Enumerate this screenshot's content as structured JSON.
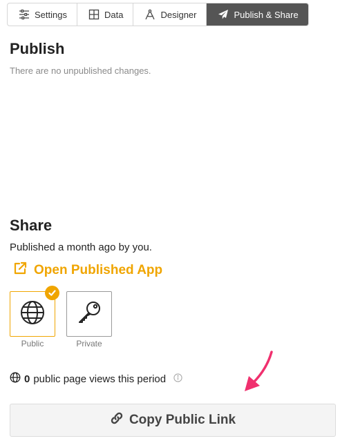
{
  "tabs": [
    {
      "label": "Settings",
      "icon": "sliders-icon",
      "active": false
    },
    {
      "label": "Data",
      "icon": "table-grid-icon",
      "active": false
    },
    {
      "label": "Designer",
      "icon": "compass-icon",
      "active": false
    },
    {
      "label": "Publish & Share",
      "icon": "paper-plane-icon",
      "active": true
    }
  ],
  "publish": {
    "title": "Publish",
    "status": "There are no unpublished changes."
  },
  "share": {
    "title": "Share",
    "published_info": "Published a month ago by you.",
    "open_link_label": "Open Published App",
    "visibility": {
      "selected": "Public",
      "options": [
        {
          "label": "Public",
          "icon": "globe-icon"
        },
        {
          "label": "Private",
          "icon": "key-icon"
        }
      ]
    },
    "views": {
      "count": "0",
      "text": "public page views this period"
    },
    "copy_button_label": "Copy Public Link"
  },
  "colors": {
    "accent": "#f0a500",
    "active_tab": "#555555",
    "annotation_arrow": "#f0306e"
  }
}
